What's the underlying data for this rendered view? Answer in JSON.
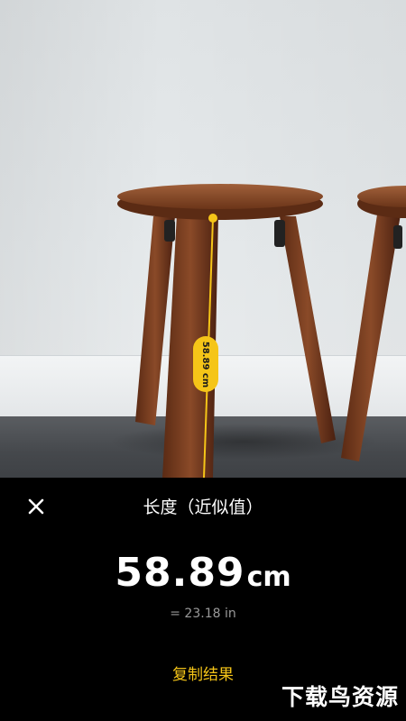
{
  "measurement": {
    "label_on_line": "58.89 cm",
    "color": "#f5c518"
  },
  "panel": {
    "close_icon": "close-icon",
    "title": "长度（近似值）",
    "value": "58.89",
    "unit": "cm",
    "inches": "= 23.18 in",
    "copy_button": "复制结果"
  },
  "watermark": "下载鸟资源"
}
